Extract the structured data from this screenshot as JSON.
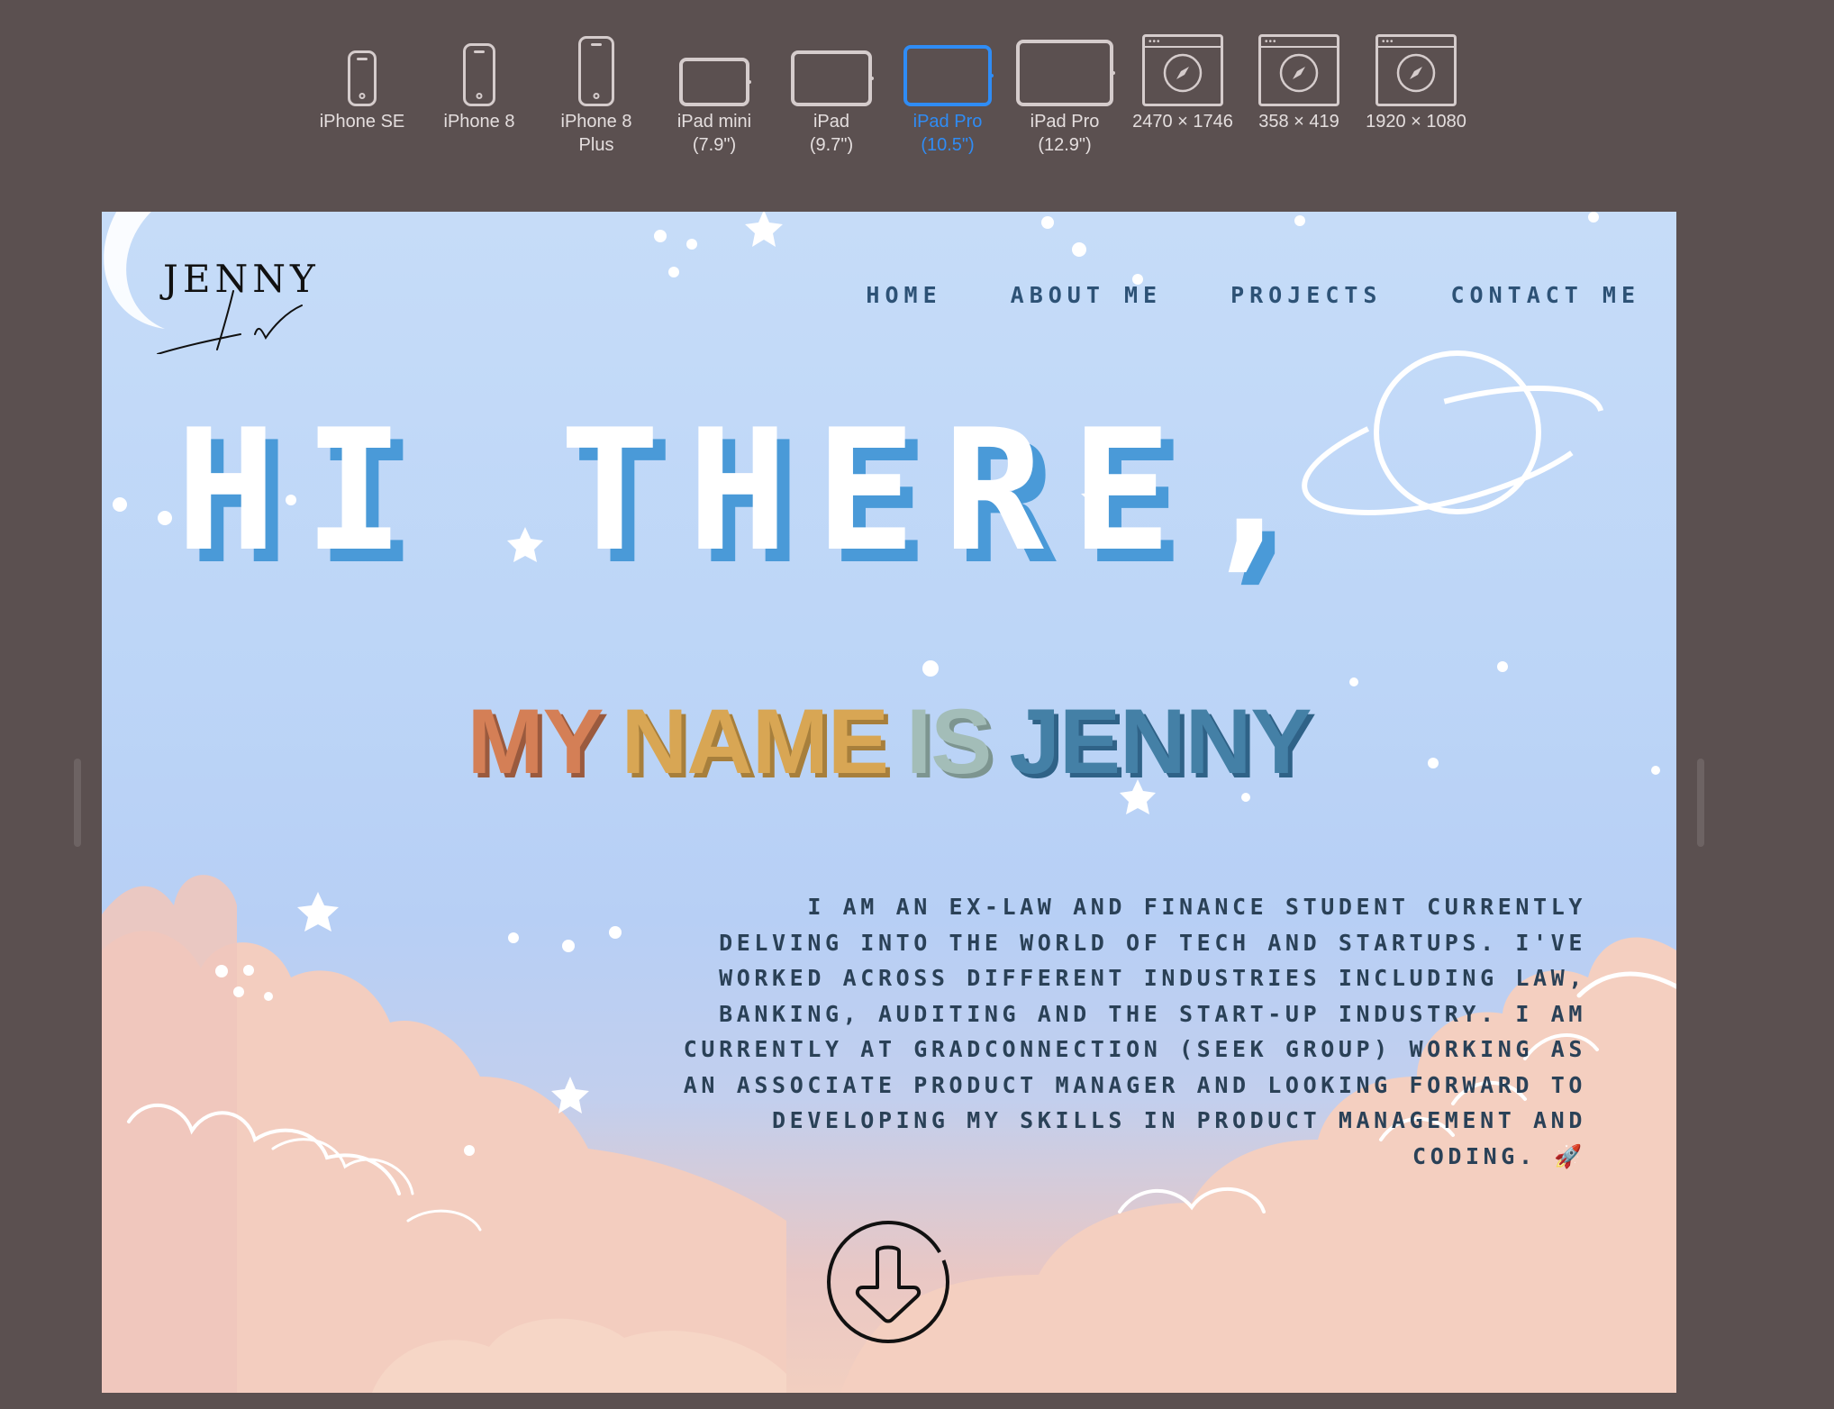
{
  "toolbar": {
    "devices": [
      {
        "label": "iPhone SE",
        "icon": "iphone-icon",
        "active": false
      },
      {
        "label": "iPhone 8",
        "icon": "iphone-icon",
        "active": false
      },
      {
        "label": "iPhone 8\nPlus",
        "icon": "iphone-icon",
        "active": false
      },
      {
        "label": "iPad mini\n(7.9\")",
        "icon": "ipad-icon",
        "active": false
      },
      {
        "label": "iPad\n(9.7\")",
        "icon": "ipad-icon",
        "active": false
      },
      {
        "label": "iPad Pro\n(10.5\")",
        "icon": "ipad-icon",
        "active": true
      },
      {
        "label": "iPad Pro\n(12.9\")",
        "icon": "ipad-icon",
        "active": false
      },
      {
        "label": "2470 × 1746",
        "icon": "safari-window-icon",
        "active": false
      },
      {
        "label": "358 × 419",
        "icon": "safari-window-icon",
        "active": false
      },
      {
        "label": "1920 × 1080",
        "icon": "safari-window-icon",
        "active": false
      }
    ],
    "active_color": "#2f8cf5"
  },
  "site": {
    "logo": {
      "line1": "JENNY",
      "line2": "Li"
    },
    "nav": [
      "HOME",
      "ABOUT ME",
      "PROJECTS",
      "CONTACT ME"
    ],
    "hero_title": "HI THERE,",
    "name_line": [
      {
        "text": "MY",
        "color": "#d47f56"
      },
      {
        "text": "NAME",
        "color": "#d8a654"
      },
      {
        "text": "IS",
        "color": "#a3bdb8"
      },
      {
        "text": "JENNY",
        "color": "#4480a6"
      }
    ],
    "bio": "I AM AN EX-LAW AND FINANCE STUDENT CURRENTLY DELVING INTO THE WORLD OF TECH AND STARTUPS. I'VE WORKED ACROSS DIFFERENT INDUSTRIES INCLUDING LAW, BANKING, AUDITING AND THE START-UP INDUSTRY. I AM CURRENTLY AT GRADCONNECTION (SEEK GROUP) WORKING AS AN ASSOCIATE PRODUCT MANAGER AND LOOKING FORWARD TO DEVELOPING MY SKILLS IN PRODUCT MANAGEMENT AND CODING. 🚀",
    "scroll_icon": "arrow-down-circle-icon"
  }
}
